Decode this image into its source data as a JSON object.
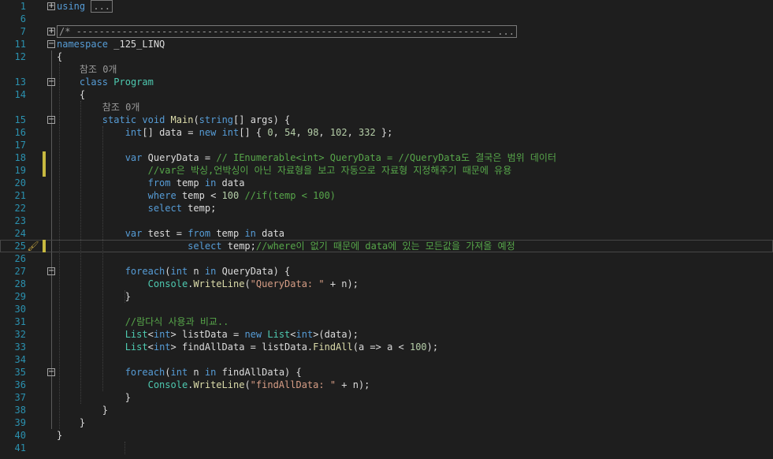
{
  "editor": {
    "rows": [
      {
        "ln": "1",
        "fold": "+",
        "tokens": [
          {
            "c": "kw",
            "t": "using"
          },
          {
            "c": "id",
            "t": " "
          },
          {
            "c": "collapsed",
            "t": "..."
          }
        ]
      },
      {
        "ln": "6",
        "tokens": []
      },
      {
        "ln": "7",
        "fold": "+",
        "tokens": [
          {
            "c": "collapsed",
            "t": "/* ------------------------------------------------------------------------- ..."
          }
        ]
      },
      {
        "ln": "11",
        "fold": "−",
        "tokens": [
          {
            "c": "kw",
            "t": "namespace"
          },
          {
            "c": "id",
            "t": " _125_LINQ"
          }
        ]
      },
      {
        "ln": "12",
        "tokens": [
          {
            "c": "id",
            "t": "{"
          }
        ]
      },
      {
        "ln": "",
        "tokens": [
          {
            "c": "lens",
            "t": "    참조 0개"
          }
        ]
      },
      {
        "ln": "13",
        "fold": "−",
        "tokens": [
          {
            "c": "id",
            "t": "    "
          },
          {
            "c": "kw",
            "t": "class"
          },
          {
            "c": "id",
            "t": " "
          },
          {
            "c": "ty",
            "t": "Program"
          }
        ]
      },
      {
        "ln": "14",
        "tokens": [
          {
            "c": "id",
            "t": "    {"
          }
        ]
      },
      {
        "ln": "",
        "tokens": [
          {
            "c": "lens",
            "t": "        참조 0개"
          }
        ]
      },
      {
        "ln": "15",
        "fold": "−",
        "tokens": [
          {
            "c": "id",
            "t": "        "
          },
          {
            "c": "kw",
            "t": "static"
          },
          {
            "c": "id",
            "t": " "
          },
          {
            "c": "kw",
            "t": "void"
          },
          {
            "c": "id",
            "t": " "
          },
          {
            "c": "mt",
            "t": "Main"
          },
          {
            "c": "id",
            "t": "("
          },
          {
            "c": "kw",
            "t": "string"
          },
          {
            "c": "id",
            "t": "[] args) {"
          }
        ]
      },
      {
        "ln": "16",
        "tokens": [
          {
            "c": "id",
            "t": "            "
          },
          {
            "c": "kw",
            "t": "int"
          },
          {
            "c": "id",
            "t": "[] data = "
          },
          {
            "c": "kw",
            "t": "new"
          },
          {
            "c": "id",
            "t": " "
          },
          {
            "c": "kw",
            "t": "int"
          },
          {
            "c": "id",
            "t": "[] { "
          },
          {
            "c": "num",
            "t": "0"
          },
          {
            "c": "id",
            "t": ", "
          },
          {
            "c": "num",
            "t": "54"
          },
          {
            "c": "id",
            "t": ", "
          },
          {
            "c": "num",
            "t": "98"
          },
          {
            "c": "id",
            "t": ", "
          },
          {
            "c": "num",
            "t": "102"
          },
          {
            "c": "id",
            "t": ", "
          },
          {
            "c": "num",
            "t": "332"
          },
          {
            "c": "id",
            "t": " };"
          }
        ]
      },
      {
        "ln": "17",
        "tokens": []
      },
      {
        "ln": "18",
        "change": true,
        "tokens": [
          {
            "c": "id",
            "t": "            "
          },
          {
            "c": "kw",
            "t": "var"
          },
          {
            "c": "id",
            "t": " QueryData = "
          },
          {
            "c": "cm",
            "t": "// IEnumerable<int> QueryData = //QueryData도 결국은 범위 데이터"
          }
        ]
      },
      {
        "ln": "19",
        "change": true,
        "tokens": [
          {
            "c": "id",
            "t": "                "
          },
          {
            "c": "cm",
            "t": "//var은 박싱,언박싱이 아닌 자료형을 보고 자동으로 자료형 지정해주기 때문에 유용"
          }
        ]
      },
      {
        "ln": "20",
        "tokens": [
          {
            "c": "id",
            "t": "                "
          },
          {
            "c": "kw",
            "t": "from"
          },
          {
            "c": "id",
            "t": " temp "
          },
          {
            "c": "kw",
            "t": "in"
          },
          {
            "c": "id",
            "t": " data"
          }
        ]
      },
      {
        "ln": "21",
        "tokens": [
          {
            "c": "id",
            "t": "                "
          },
          {
            "c": "kw",
            "t": "where"
          },
          {
            "c": "id",
            "t": " temp < "
          },
          {
            "c": "num",
            "t": "100"
          },
          {
            "c": "id",
            "t": " "
          },
          {
            "c": "cm",
            "t": "//if(temp < 100)"
          }
        ]
      },
      {
        "ln": "22",
        "tokens": [
          {
            "c": "id",
            "t": "                "
          },
          {
            "c": "kw",
            "t": "select"
          },
          {
            "c": "id",
            "t": " temp;"
          }
        ]
      },
      {
        "ln": "23",
        "tokens": []
      },
      {
        "ln": "24",
        "tokens": [
          {
            "c": "id",
            "t": "            "
          },
          {
            "c": "kw",
            "t": "var"
          },
          {
            "c": "id",
            "t": " test = "
          },
          {
            "c": "kw",
            "t": "from"
          },
          {
            "c": "id",
            "t": " temp "
          },
          {
            "c": "kw",
            "t": "in"
          },
          {
            "c": "id",
            "t": " data"
          }
        ]
      },
      {
        "ln": "25",
        "change": true,
        "current": true,
        "glyph": "🖌",
        "tokens": [
          {
            "c": "id",
            "t": "                       "
          },
          {
            "c": "kw",
            "t": "select"
          },
          {
            "c": "id",
            "t": " temp;"
          },
          {
            "c": "cm",
            "t": "//where이 없기 때문에 data에 있는 모든값을 가져올 예정"
          }
        ]
      },
      {
        "ln": "26",
        "tokens": []
      },
      {
        "ln": "27",
        "fold": "−",
        "tokens": [
          {
            "c": "id",
            "t": "            "
          },
          {
            "c": "kw",
            "t": "foreach"
          },
          {
            "c": "id",
            "t": "("
          },
          {
            "c": "kw",
            "t": "int"
          },
          {
            "c": "id",
            "t": " n "
          },
          {
            "c": "kw",
            "t": "in"
          },
          {
            "c": "id",
            "t": " QueryData) {"
          }
        ]
      },
      {
        "ln": "28",
        "tokens": [
          {
            "c": "id",
            "t": "                "
          },
          {
            "c": "ty",
            "t": "Console"
          },
          {
            "c": "id",
            "t": "."
          },
          {
            "c": "mt",
            "t": "WriteLine"
          },
          {
            "c": "id",
            "t": "("
          },
          {
            "c": "str",
            "t": "\"QueryData: \""
          },
          {
            "c": "id",
            "t": " + n);"
          }
        ]
      },
      {
        "ln": "29",
        "tokens": [
          {
            "c": "id",
            "t": "            }"
          }
        ]
      },
      {
        "ln": "30",
        "tokens": []
      },
      {
        "ln": "31",
        "tokens": [
          {
            "c": "id",
            "t": "            "
          },
          {
            "c": "cm",
            "t": "//람다식 사용과 비교.."
          }
        ]
      },
      {
        "ln": "32",
        "tokens": [
          {
            "c": "id",
            "t": "            "
          },
          {
            "c": "ty",
            "t": "List"
          },
          {
            "c": "id",
            "t": "<"
          },
          {
            "c": "kw",
            "t": "int"
          },
          {
            "c": "id",
            "t": "> listData = "
          },
          {
            "c": "kw",
            "t": "new"
          },
          {
            "c": "id",
            "t": " "
          },
          {
            "c": "ty",
            "t": "List"
          },
          {
            "c": "id",
            "t": "<"
          },
          {
            "c": "kw",
            "t": "int"
          },
          {
            "c": "id",
            "t": ">(data);"
          }
        ]
      },
      {
        "ln": "33",
        "tokens": [
          {
            "c": "id",
            "t": "            "
          },
          {
            "c": "ty",
            "t": "List"
          },
          {
            "c": "id",
            "t": "<"
          },
          {
            "c": "kw",
            "t": "int"
          },
          {
            "c": "id",
            "t": "> findAllData = listData."
          },
          {
            "c": "mt",
            "t": "FindAll"
          },
          {
            "c": "id",
            "t": "(a => a < "
          },
          {
            "c": "num",
            "t": "100"
          },
          {
            "c": "id",
            "t": ");"
          }
        ]
      },
      {
        "ln": "34",
        "tokens": []
      },
      {
        "ln": "35",
        "fold": "−",
        "tokens": [
          {
            "c": "id",
            "t": "            "
          },
          {
            "c": "kw",
            "t": "foreach"
          },
          {
            "c": "id",
            "t": "("
          },
          {
            "c": "kw",
            "t": "int"
          },
          {
            "c": "id",
            "t": " n "
          },
          {
            "c": "kw",
            "t": "in"
          },
          {
            "c": "id",
            "t": " findAllData) {"
          }
        ]
      },
      {
        "ln": "36",
        "tokens": [
          {
            "c": "id",
            "t": "                "
          },
          {
            "c": "ty",
            "t": "Console"
          },
          {
            "c": "id",
            "t": "."
          },
          {
            "c": "mt",
            "t": "WriteLine"
          },
          {
            "c": "id",
            "t": "("
          },
          {
            "c": "str",
            "t": "\"findAllData: \""
          },
          {
            "c": "id",
            "t": " + n);"
          }
        ]
      },
      {
        "ln": "37",
        "tokens": [
          {
            "c": "id",
            "t": "            }"
          }
        ]
      },
      {
        "ln": "38",
        "tokens": [
          {
            "c": "id",
            "t": "        }"
          }
        ]
      },
      {
        "ln": "39",
        "tokens": [
          {
            "c": "id",
            "t": "    }"
          }
        ]
      },
      {
        "ln": "40",
        "tokens": [
          {
            "c": "id",
            "t": "}"
          }
        ]
      },
      {
        "ln": "41",
        "tokens": []
      }
    ]
  }
}
